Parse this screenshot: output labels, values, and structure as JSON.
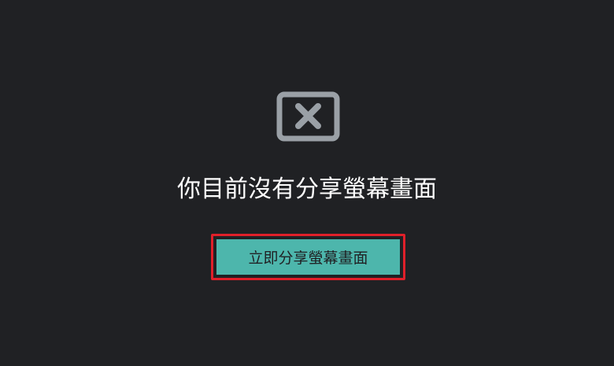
{
  "message": "你目前沒有分享螢幕畫面",
  "share_button": {
    "label": "立即分享螢幕畫面"
  },
  "icons": {
    "status_icon": "screen-share-off-icon"
  },
  "colors": {
    "background": "#202124",
    "icon": "#9aa0a6",
    "button_fill": "#4db6ac",
    "highlight_border": "#e0202a",
    "message_text": "#ffffff"
  }
}
